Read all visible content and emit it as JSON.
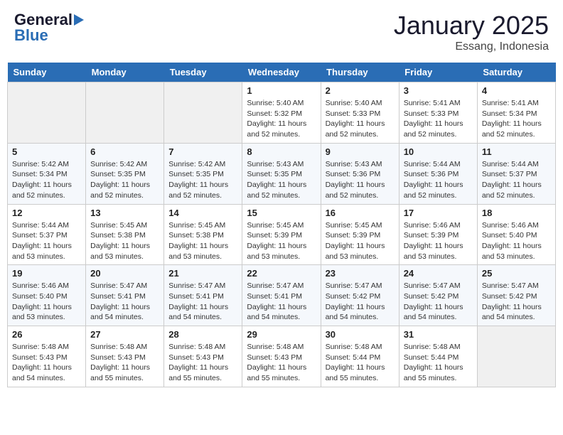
{
  "header": {
    "logo_line1": "General",
    "logo_line2": "Blue",
    "month": "January 2025",
    "location": "Essang, Indonesia"
  },
  "weekdays": [
    "Sunday",
    "Monday",
    "Tuesday",
    "Wednesday",
    "Thursday",
    "Friday",
    "Saturday"
  ],
  "weeks": [
    [
      {
        "day": "",
        "info": ""
      },
      {
        "day": "",
        "info": ""
      },
      {
        "day": "",
        "info": ""
      },
      {
        "day": "1",
        "info": "Sunrise: 5:40 AM\nSunset: 5:32 PM\nDaylight: 11 hours and 52 minutes."
      },
      {
        "day": "2",
        "info": "Sunrise: 5:40 AM\nSunset: 5:33 PM\nDaylight: 11 hours and 52 minutes."
      },
      {
        "day": "3",
        "info": "Sunrise: 5:41 AM\nSunset: 5:33 PM\nDaylight: 11 hours and 52 minutes."
      },
      {
        "day": "4",
        "info": "Sunrise: 5:41 AM\nSunset: 5:34 PM\nDaylight: 11 hours and 52 minutes."
      }
    ],
    [
      {
        "day": "5",
        "info": "Sunrise: 5:42 AM\nSunset: 5:34 PM\nDaylight: 11 hours and 52 minutes."
      },
      {
        "day": "6",
        "info": "Sunrise: 5:42 AM\nSunset: 5:35 PM\nDaylight: 11 hours and 52 minutes."
      },
      {
        "day": "7",
        "info": "Sunrise: 5:42 AM\nSunset: 5:35 PM\nDaylight: 11 hours and 52 minutes."
      },
      {
        "day": "8",
        "info": "Sunrise: 5:43 AM\nSunset: 5:35 PM\nDaylight: 11 hours and 52 minutes."
      },
      {
        "day": "9",
        "info": "Sunrise: 5:43 AM\nSunset: 5:36 PM\nDaylight: 11 hours and 52 minutes."
      },
      {
        "day": "10",
        "info": "Sunrise: 5:44 AM\nSunset: 5:36 PM\nDaylight: 11 hours and 52 minutes."
      },
      {
        "day": "11",
        "info": "Sunrise: 5:44 AM\nSunset: 5:37 PM\nDaylight: 11 hours and 52 minutes."
      }
    ],
    [
      {
        "day": "12",
        "info": "Sunrise: 5:44 AM\nSunset: 5:37 PM\nDaylight: 11 hours and 53 minutes."
      },
      {
        "day": "13",
        "info": "Sunrise: 5:45 AM\nSunset: 5:38 PM\nDaylight: 11 hours and 53 minutes."
      },
      {
        "day": "14",
        "info": "Sunrise: 5:45 AM\nSunset: 5:38 PM\nDaylight: 11 hours and 53 minutes."
      },
      {
        "day": "15",
        "info": "Sunrise: 5:45 AM\nSunset: 5:39 PM\nDaylight: 11 hours and 53 minutes."
      },
      {
        "day": "16",
        "info": "Sunrise: 5:45 AM\nSunset: 5:39 PM\nDaylight: 11 hours and 53 minutes."
      },
      {
        "day": "17",
        "info": "Sunrise: 5:46 AM\nSunset: 5:39 PM\nDaylight: 11 hours and 53 minutes."
      },
      {
        "day": "18",
        "info": "Sunrise: 5:46 AM\nSunset: 5:40 PM\nDaylight: 11 hours and 53 minutes."
      }
    ],
    [
      {
        "day": "19",
        "info": "Sunrise: 5:46 AM\nSunset: 5:40 PM\nDaylight: 11 hours and 53 minutes."
      },
      {
        "day": "20",
        "info": "Sunrise: 5:47 AM\nSunset: 5:41 PM\nDaylight: 11 hours and 54 minutes."
      },
      {
        "day": "21",
        "info": "Sunrise: 5:47 AM\nSunset: 5:41 PM\nDaylight: 11 hours and 54 minutes."
      },
      {
        "day": "22",
        "info": "Sunrise: 5:47 AM\nSunset: 5:41 PM\nDaylight: 11 hours and 54 minutes."
      },
      {
        "day": "23",
        "info": "Sunrise: 5:47 AM\nSunset: 5:42 PM\nDaylight: 11 hours and 54 minutes."
      },
      {
        "day": "24",
        "info": "Sunrise: 5:47 AM\nSunset: 5:42 PM\nDaylight: 11 hours and 54 minutes."
      },
      {
        "day": "25",
        "info": "Sunrise: 5:47 AM\nSunset: 5:42 PM\nDaylight: 11 hours and 54 minutes."
      }
    ],
    [
      {
        "day": "26",
        "info": "Sunrise: 5:48 AM\nSunset: 5:43 PM\nDaylight: 11 hours and 54 minutes."
      },
      {
        "day": "27",
        "info": "Sunrise: 5:48 AM\nSunset: 5:43 PM\nDaylight: 11 hours and 55 minutes."
      },
      {
        "day": "28",
        "info": "Sunrise: 5:48 AM\nSunset: 5:43 PM\nDaylight: 11 hours and 55 minutes."
      },
      {
        "day": "29",
        "info": "Sunrise: 5:48 AM\nSunset: 5:43 PM\nDaylight: 11 hours and 55 minutes."
      },
      {
        "day": "30",
        "info": "Sunrise: 5:48 AM\nSunset: 5:44 PM\nDaylight: 11 hours and 55 minutes."
      },
      {
        "day": "31",
        "info": "Sunrise: 5:48 AM\nSunset: 5:44 PM\nDaylight: 11 hours and 55 minutes."
      },
      {
        "day": "",
        "info": ""
      }
    ]
  ]
}
